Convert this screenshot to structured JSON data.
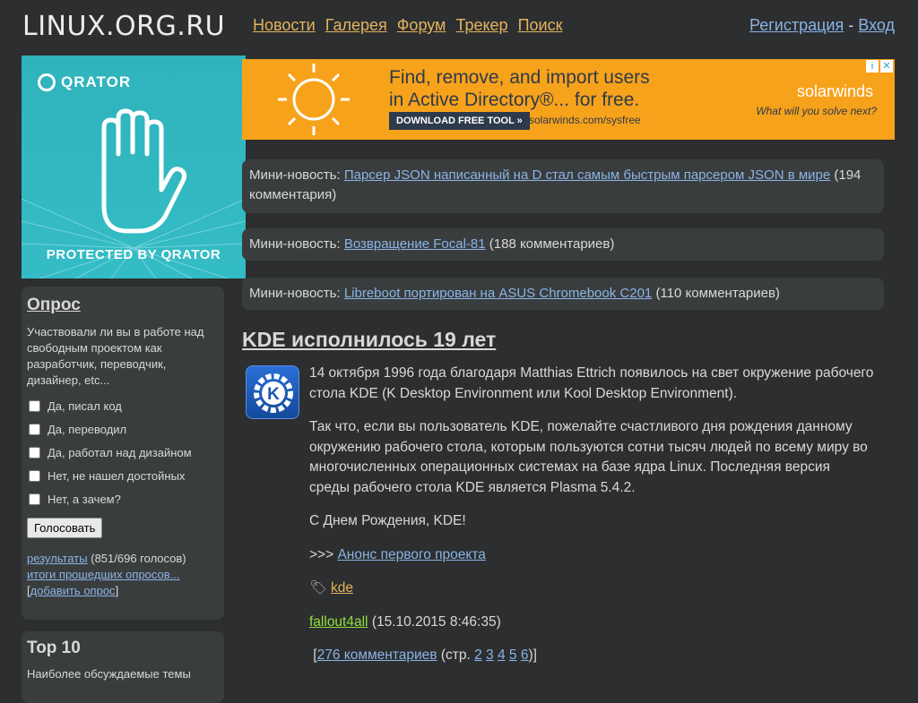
{
  "header": {
    "logo": "LINUX.ORG.RU",
    "nav": [
      "Новости",
      "Галерея",
      "Форум",
      "Трекер",
      "Поиск"
    ],
    "register": "Регистрация",
    "separator": "-",
    "login": "Вход"
  },
  "qrator": {
    "brand": "QRATOR",
    "label": "PROTECTED BY QRATOR"
  },
  "ad": {
    "line1": "Find, remove, and import users",
    "line2": "in Active Directory®... for free.",
    "button": "DOWNLOAD FREE TOOL »",
    "url": "solarwinds.com/sysfree",
    "brand": "solarwinds",
    "slogan": "What will you solve next?"
  },
  "poll": {
    "title": "Опрос",
    "question": "Участвовали ли вы в работе над свободным проектом как разработчик, переводчик, дизайнер, etc...",
    "options": [
      "Да, писал код",
      "Да, переводил",
      "Да, работал над дизайном",
      "Нет, не нашел достойных",
      "Нет, а зачем?"
    ],
    "vote_button": "Голосовать",
    "results_link": "результаты",
    "results_count": "(851/696 голосов)",
    "past_link": "итоги прошедших опросов...",
    "add_link": "добавить опрос",
    "bracket_open": "[",
    "bracket_close": "]"
  },
  "top10": {
    "title": "Top 10",
    "subtitle": "Наиболее обсуждаемые темы"
  },
  "mini_news": [
    {
      "prefix": "Мини-новость:",
      "title": "Парсер JSON написанный на D стал самым быстрым парсером JSON в мире",
      "comments": "(194 комментария)"
    },
    {
      "prefix": "Мини-новость:",
      "title": "Возвращение Focal-81",
      "comments": "(188 комментариев)"
    },
    {
      "prefix": "Мини-новость:",
      "title": "Libreboot портирован на ASUS Chromebook C201",
      "comments": "(110 комментариев)"
    }
  ],
  "article": {
    "title": "KDE исполнилось 19 лет",
    "p1": "14 октября 1996 года благодаря Matthias Ettrich появилось на свет окружение рабочего стола KDE (K Desktop Environment или Kool Desktop Environment).",
    "p2": "Так что, если вы пользователь KDE, пожелайте счастливого дня рождения данному окружению рабочего стола, которым пользуются сотни тысяч людей по всему миру во многочисленных операционных системах на базе ядра Linux. Последняя версия среды рабочего стола KDE является Plasma 5.4.2.",
    "p3": "С Днем Рождения, KDE!",
    "link_prefix": ">>>",
    "link": "Анонс первого проекта",
    "tag": "kde",
    "author": "fallout4all",
    "date": "(15.10.2015 8:46:35)",
    "comments_link": "276 комментариев",
    "pages_prefix": "(стр.",
    "pages": [
      "2",
      "3",
      "4",
      "5",
      "6"
    ],
    "pages_suffix": ")"
  }
}
